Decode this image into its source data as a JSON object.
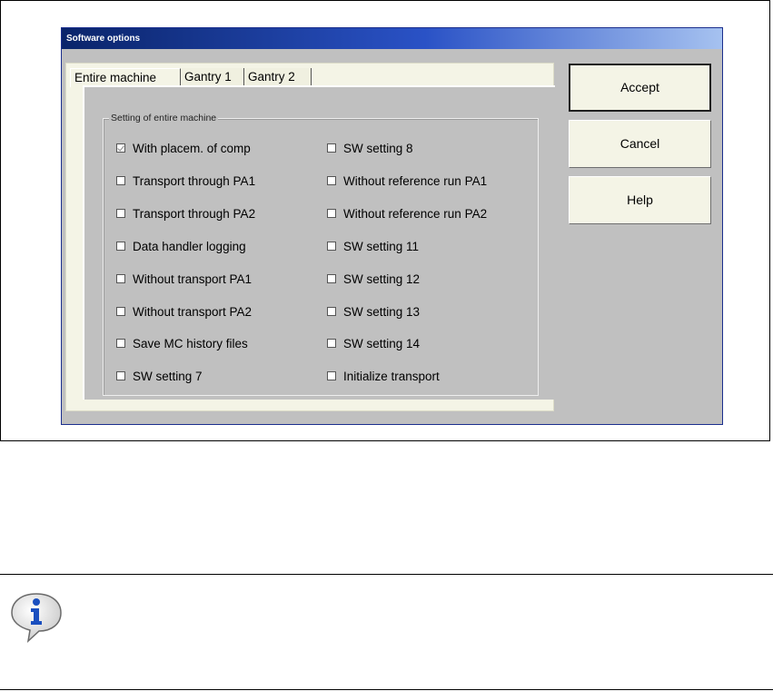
{
  "window": {
    "title": "Software options"
  },
  "tabs": [
    {
      "label": "Entire machine",
      "active": true
    },
    {
      "label": "Gantry 1",
      "active": false
    },
    {
      "label": "Gantry 2",
      "active": false
    }
  ],
  "group": {
    "label": "Setting of entire machine"
  },
  "options_left": [
    {
      "label": "With placem. of comp",
      "checked": true,
      "disabled": true
    },
    {
      "label": "Transport through PA1",
      "checked": false
    },
    {
      "label": "Transport through PA2",
      "checked": false
    },
    {
      "label": "Data handler logging",
      "checked": false
    },
    {
      "label": "Without transport PA1",
      "checked": false
    },
    {
      "label": "Without transport PA2",
      "checked": false
    },
    {
      "label": "Save MC history files",
      "checked": false
    },
    {
      "label": "SW setting 7",
      "checked": false
    }
  ],
  "options_right": [
    {
      "label": "SW setting 8",
      "checked": false
    },
    {
      "label": "Without reference run PA1",
      "checked": false
    },
    {
      "label": "Without reference run PA2",
      "checked": false
    },
    {
      "label": "SW setting 11",
      "checked": false
    },
    {
      "label": "SW setting 12",
      "checked": false
    },
    {
      "label": "SW setting 13",
      "checked": false
    },
    {
      "label": "SW setting 14",
      "checked": false
    },
    {
      "label": "Initialize transport",
      "checked": false
    }
  ],
  "buttons": {
    "accept": "Accept",
    "cancel": "Cancel",
    "help": "Help"
  },
  "icons": {
    "info": "info-icon"
  },
  "colors": {
    "title_bar_start": "#0a246a",
    "title_bar_end": "#a6c2f0",
    "dialog_bg": "#c0c0c0",
    "button_face": "#f4f4e6",
    "info_icon_blue": "#1a4fbf"
  }
}
